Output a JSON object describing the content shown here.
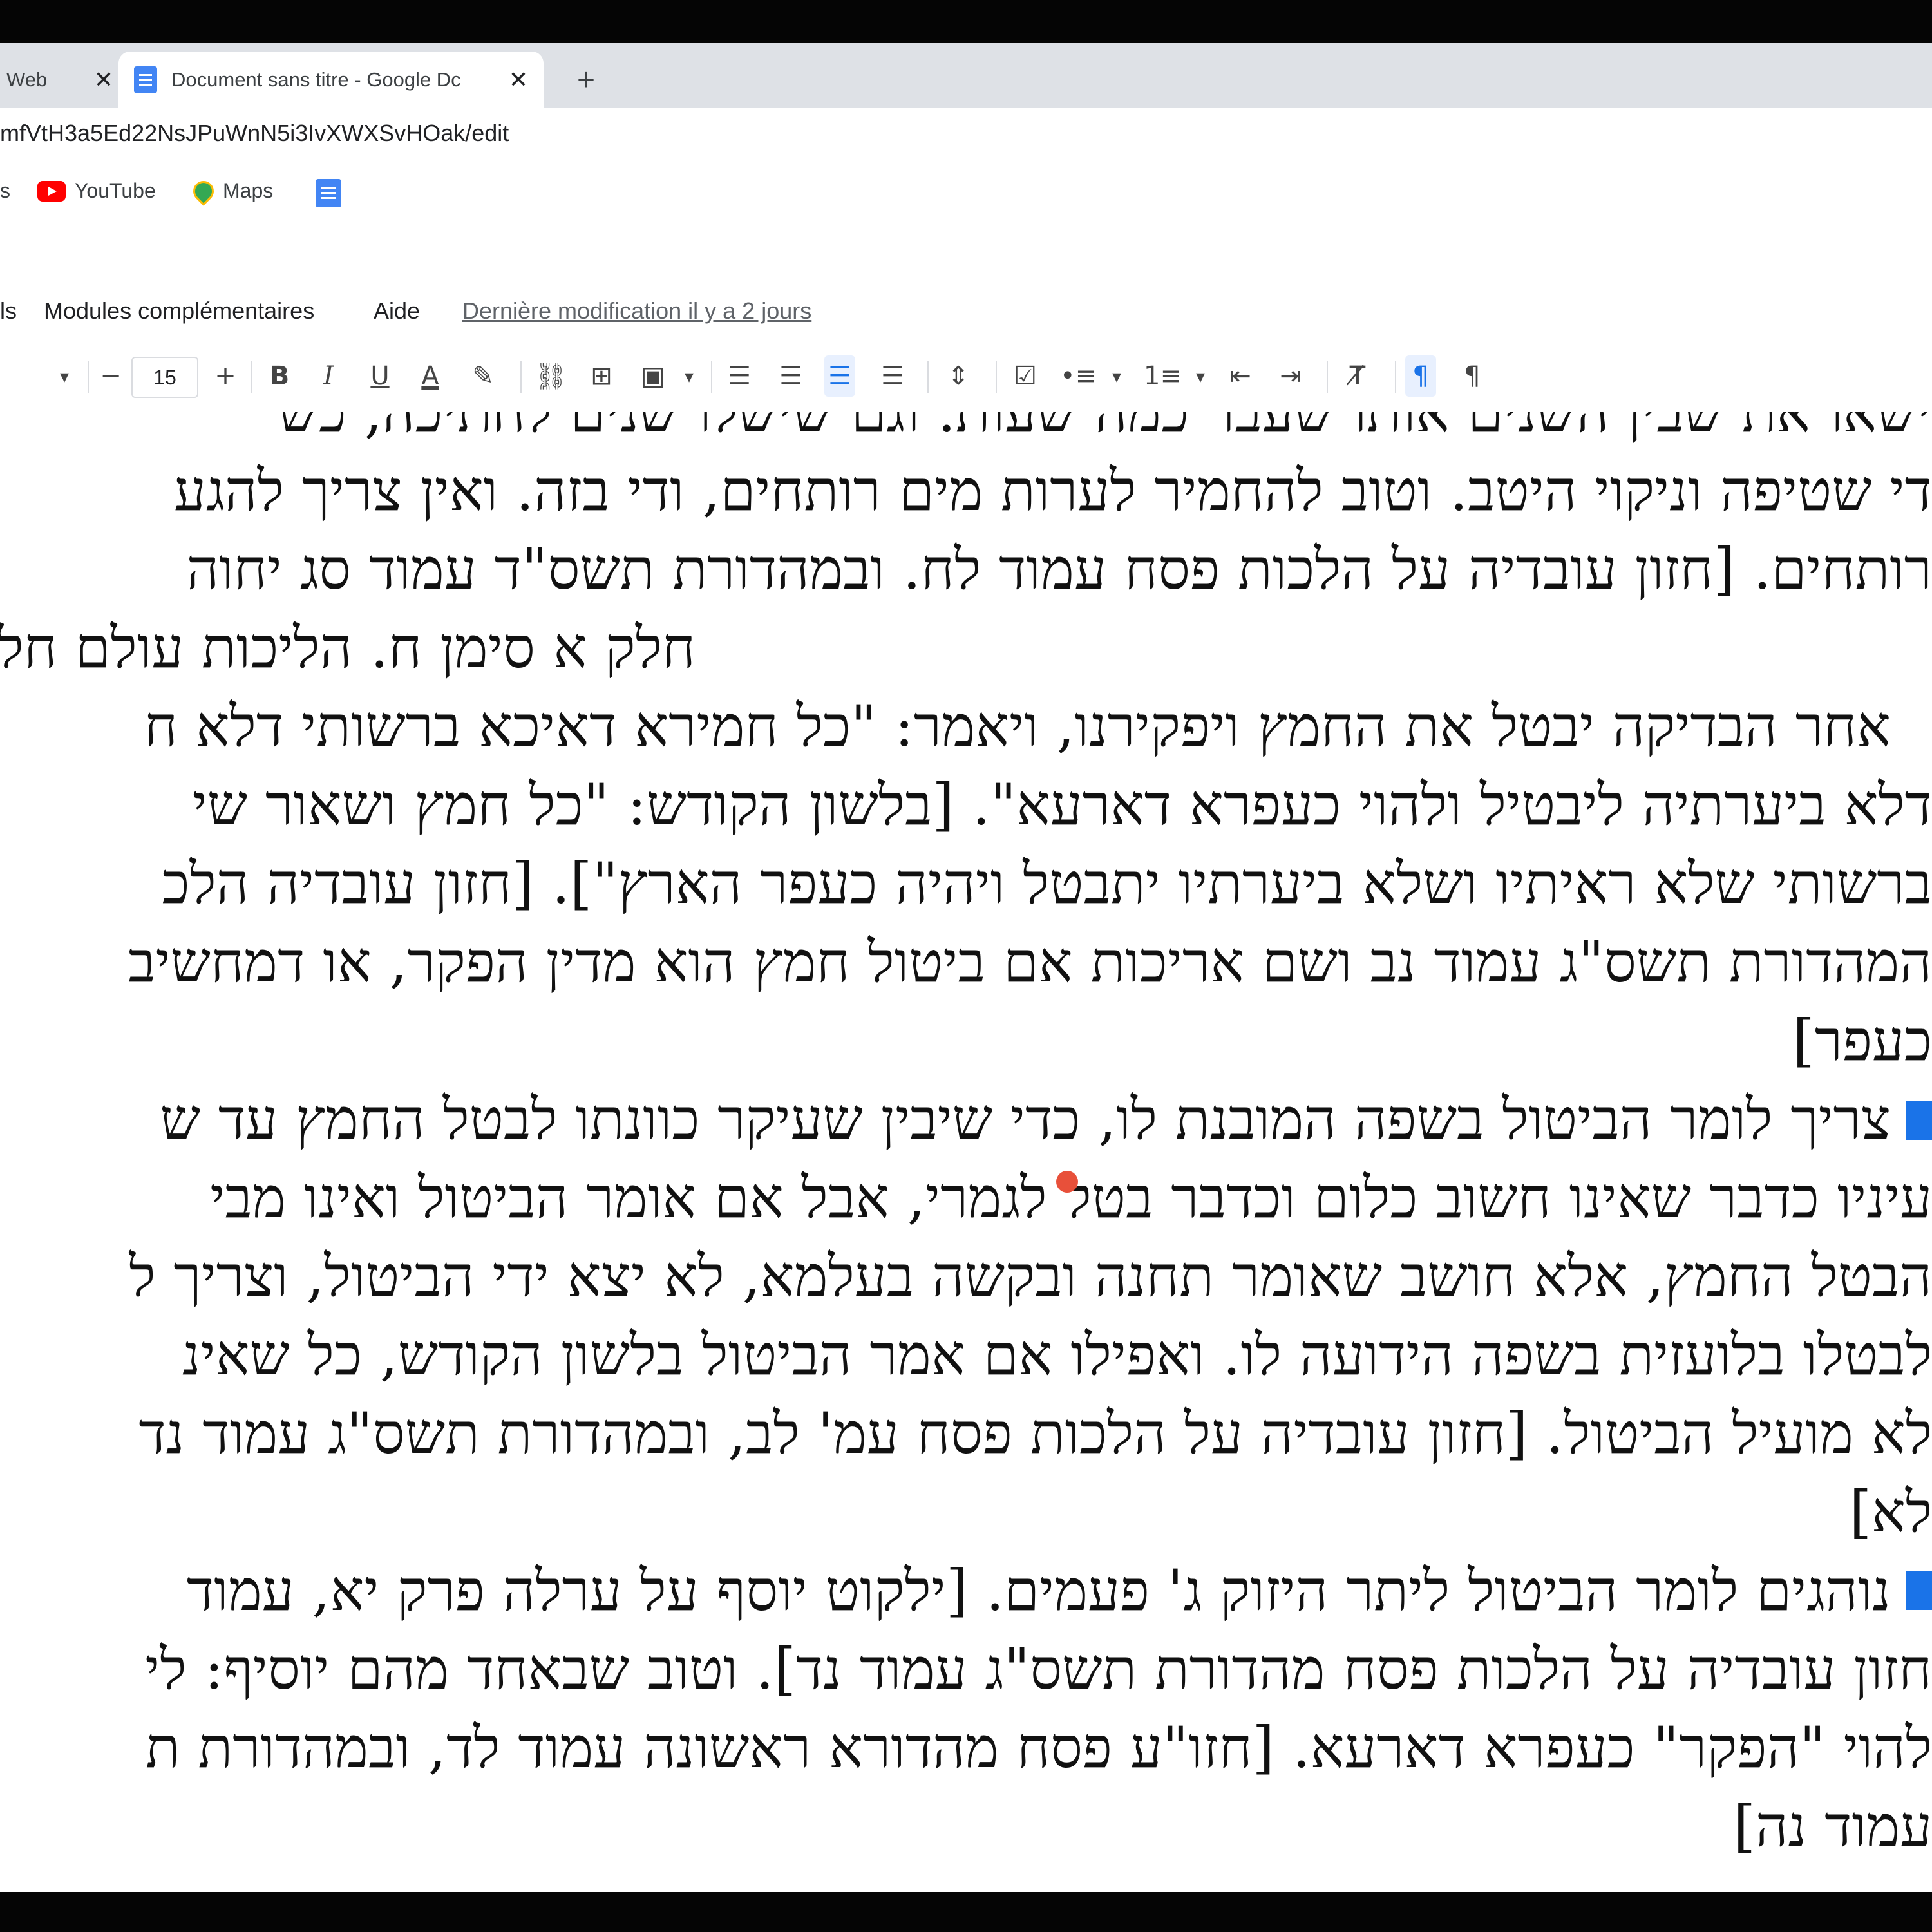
{
  "browser": {
    "tabs": [
      {
        "label": "Web",
        "close": "✕"
      },
      {
        "label": "Document sans titre - Google Dc",
        "close": "✕"
      }
    ],
    "new_tab": "+",
    "url": "mfVtH3a5Ed22NsJPuWnN5i3IvXWXSvHOak/edit",
    "bookmarks": [
      "s",
      "YouTube",
      "Maps"
    ]
  },
  "docs": {
    "menu": [
      "ls",
      "Modules complémentaires",
      "Aide"
    ],
    "last_modified": "Dernière modification il y a 2 jours",
    "toolbar": {
      "font_size": "15",
      "minus": "−",
      "plus": "+",
      "bold": "B",
      "italic": "I",
      "underline": "U",
      "text_color": "A"
    }
  },
  "document": {
    "lines": [
      "ישאו את שבין השנים אותו שעבר כמה שעות. וגם שישלו שנים לחתיכה, כש",
      "די שטיפה וניקוי היטב. וטוב להחמיר לערות מים רותחים, ודי בזה. ואין צריך להגע",
      "רותחים. [חזון עובדיה על הלכות פסח עמוד לח. ובמהדורת תשס\"ד עמוד סג יחוה",
      "חלק א סימן ח. הליכות עולם חלק א' עמוד רעט, רפא",
      "אחר הבדיקה יבטל את החמץ ויפקירנו, ויאמר: \"כל חמירא דאיכא ברשותי דלא ח",
      "דלא ביערתיה ליבטיל ולהוי כעפרא דארעא\". [בלשון הקודש: \"כל חמץ ושאור שי",
      "ברשותי שלא ראיתיו ושלא ביערתיו יתבטל ויהיה כעפר הארץ\"]. [חזון עובדיה הלכ",
      "המהדורת תשס\"ג עמוד נב ושם אריכות אם ביטול חמץ הוא מדין הפקר, או דמחשיב",
      "כעפר]",
      "צריך לומר הביטול בשפה המובנת לו, כדי שיבין שעיקר כוונתו לבטל החמץ עד ש",
      "עיניו כדבר שאינו חשוב כלום וכדבר בטל לגמרי, אבל אם אומר הביטול ואינו מבי",
      "הבטל החמץ, אלא חושב שאומר תחנה ובקשה בעלמא, לא יצא ידי הביטול, וצריך ל",
      "לבטלו בלועזית בשפה הידועה לו. ואפילו אם אמר הביטול בלשון הקודש, כל שאינ",
      "לא מועיל הביטול. [חזון עובדיה על הלכות פסח עמ' לב, ובמהדורת תשס\"ג עמוד נד",
      "לא]",
      "נוהגים לומר הביטול ליתר היזוק ג' פעמים. [ילקוט יוסף על ערלה פרק יא, עמוד",
      "חזון עובדיה על הלכות פסח מהדורת תשס\"ג עמוד נד]. וטוב שבאחד מהם יוסיף: לי",
      "להוי \"הפקר\" כעפרא דארעא. [חזו\"ע פסח מהדורא ראשונה עמוד לד, ובמהדורת ת",
      "עמוד נה]"
    ]
  },
  "colors": {
    "accent": "#1a73e8",
    "spell_error": "#d93025",
    "youtube": "#ff0000"
  }
}
